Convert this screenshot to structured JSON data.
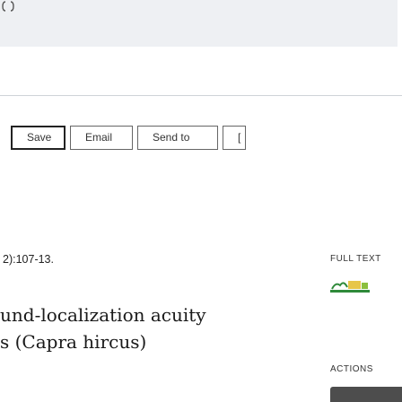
{
  "header": {
    "corner_icon": "rounded-bracket-glyph"
  },
  "toolbar": {
    "save_label": "Save",
    "email_label": "Email",
    "send_to_label": "Send to",
    "overflow_label": "["
  },
  "citation": {
    "suffix": "2):107-13."
  },
  "article": {
    "title_line_1": "und-localization acuity",
    "title_line_2": "s (Capra hircus)"
  },
  "sidebar": {
    "full_text_label": "FULL TEXT",
    "full_text_logo_icon": "publisher-logo",
    "actions_label": "ACTIONS",
    "action_bar_icon": "action-button"
  },
  "colors": {
    "header_band": "#eef0f3",
    "rule": "#cfd3d8",
    "action_bar": "#4d4d4d",
    "logo_accent": "#2f8a3a"
  }
}
